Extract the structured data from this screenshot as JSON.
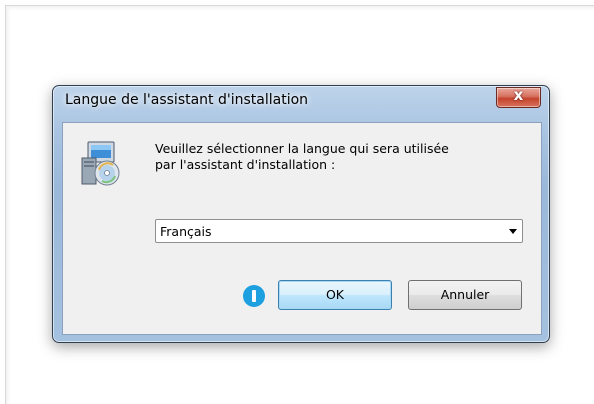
{
  "dialog": {
    "title": "Langue de l'assistant d'installation",
    "close_label": "x",
    "message_line1": "Veuillez sélectionner la langue qui sera utilisée",
    "message_line2": "par l'assistant d'installation :",
    "language_select": {
      "selected": "Français"
    },
    "ok_label": "OK",
    "cancel_label": "Annuler"
  },
  "annotation": {
    "marker_icon": "info-marker-icon",
    "marker_color": "#1e9fe0"
  },
  "colors": {
    "titlebar": "#a9c4e2",
    "client_bg": "#f0f0f0",
    "close_button": "#c4432c"
  }
}
